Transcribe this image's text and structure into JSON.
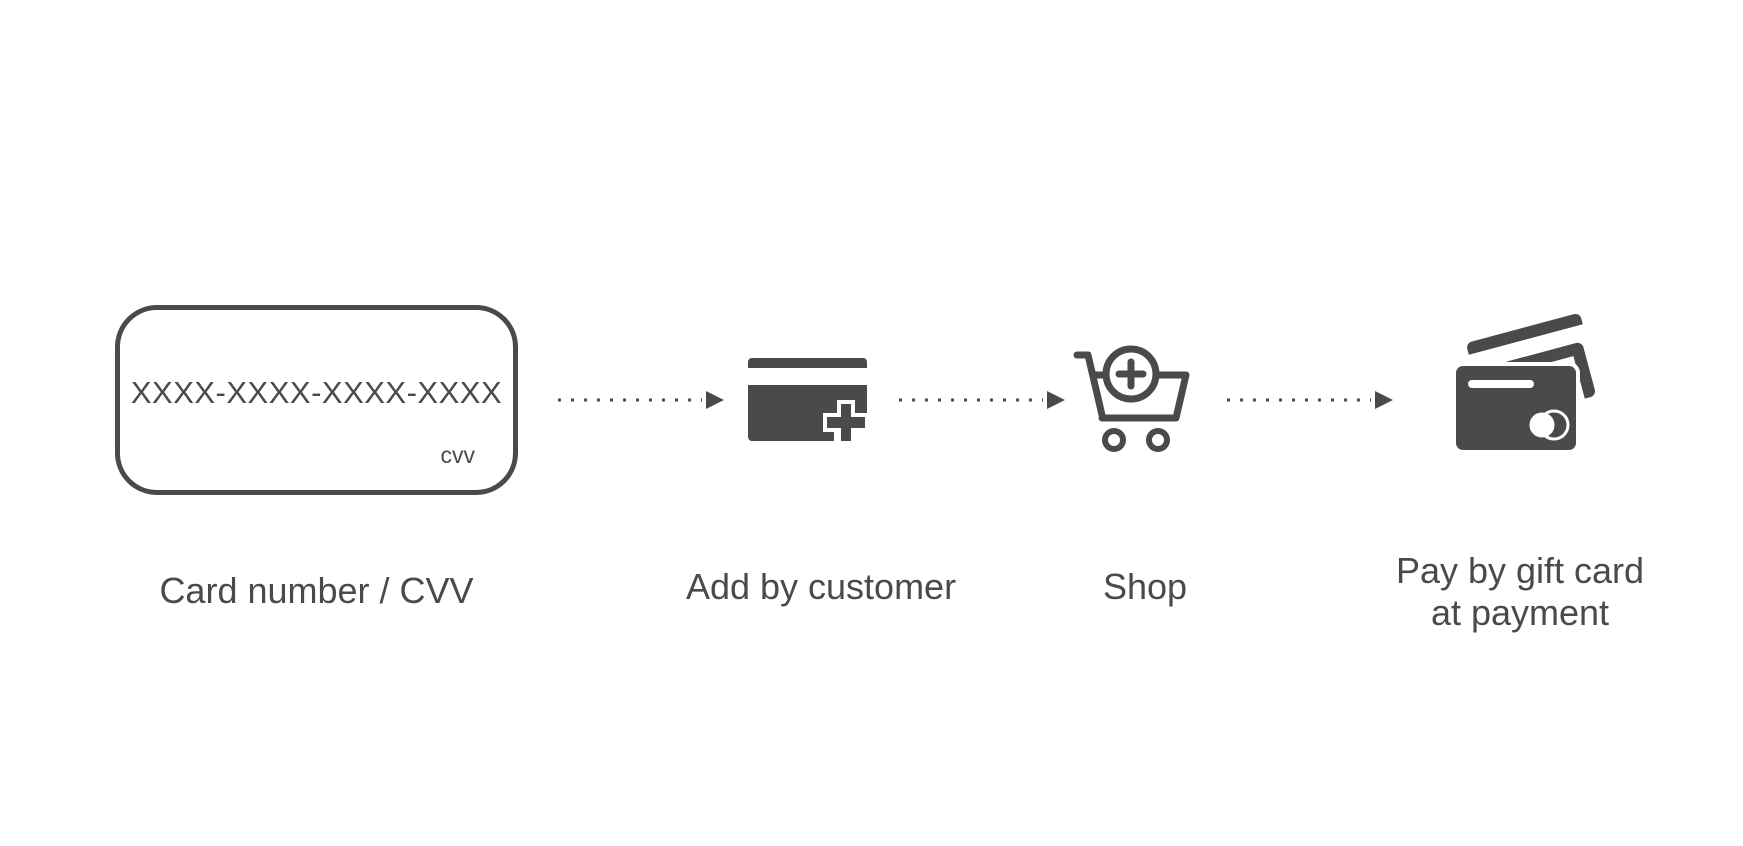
{
  "diagram": {
    "card": {
      "number_placeholder": "XXXX-XXXX-XXXX-XXXX",
      "cvv_text": "cvv"
    },
    "steps": [
      {
        "label": "Card number / CVV",
        "icon": "card-outline"
      },
      {
        "label": "Add by customer",
        "icon": "card-add-icon"
      },
      {
        "label": "Shop",
        "icon": "shopping-cart-add-icon"
      },
      {
        "label_lines": [
          "Pay by gift card",
          "at payment"
        ],
        "icon": "credit-cards-icon"
      }
    ],
    "connector": "dotted-arrow"
  },
  "colors": {
    "foreground": "#4a4a4c",
    "background": "#ffffff"
  }
}
